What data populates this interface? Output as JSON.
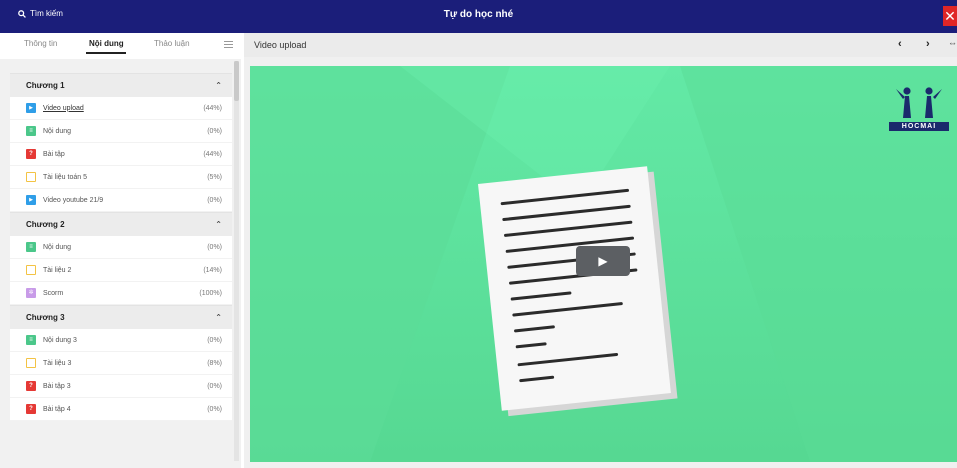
{
  "topbar": {
    "search_label": "Tìm kiếm",
    "title": "Tự do học nhé",
    "close_label": "✕"
  },
  "sidebar": {
    "tabs": [
      "Thông tin",
      "Nội dung",
      "Thảo luận"
    ],
    "chapters": [
      {
        "title": "Chương 1",
        "items": [
          {
            "label": "Video upload",
            "pct": "(44%)",
            "icon": "video-icon",
            "color": "blue"
          },
          {
            "label": "Nội dung",
            "pct": "(0%)",
            "icon": "document-icon",
            "color": "green"
          },
          {
            "label": "Bài tập",
            "pct": "(44%)",
            "icon": "quiz-icon",
            "color": "red"
          },
          {
            "label": "Tài liệu toán 5",
            "pct": "(5%)",
            "icon": "file-icon",
            "color": "yellow"
          },
          {
            "label": "Video youtube 21/9",
            "pct": "(0%)",
            "icon": "video-icon",
            "color": "blue"
          }
        ]
      },
      {
        "title": "Chương 2",
        "items": [
          {
            "label": "Nội dung",
            "pct": "(0%)",
            "icon": "document-icon",
            "color": "green"
          },
          {
            "label": "Tài liệu 2",
            "pct": "(14%)",
            "icon": "file-icon",
            "color": "yellow"
          },
          {
            "label": "Scorm",
            "pct": "(100%)",
            "icon": "scorm-icon",
            "color": "purple"
          }
        ]
      },
      {
        "title": "Chương 3",
        "items": [
          {
            "label": "Nội dung 3",
            "pct": "(0%)",
            "icon": "document-icon",
            "color": "green"
          },
          {
            "label": "Tài liệu 3",
            "pct": "(8%)",
            "icon": "file-icon",
            "color": "yellow"
          },
          {
            "label": "Bài tập 3",
            "pct": "(0%)",
            "icon": "quiz-icon",
            "color": "red"
          },
          {
            "label": "Bài tập 4",
            "pct": "(0%)",
            "icon": "quiz-icon",
            "color": "red"
          }
        ]
      }
    ]
  },
  "main": {
    "title": "Video upload",
    "prev": "‹",
    "next": "›",
    "logo_text": "HOCMAI",
    "play": "▶"
  },
  "colors": {
    "topbar": "#1b1e7a",
    "video_bg": "#5fe3a0",
    "close": "#e02626"
  }
}
